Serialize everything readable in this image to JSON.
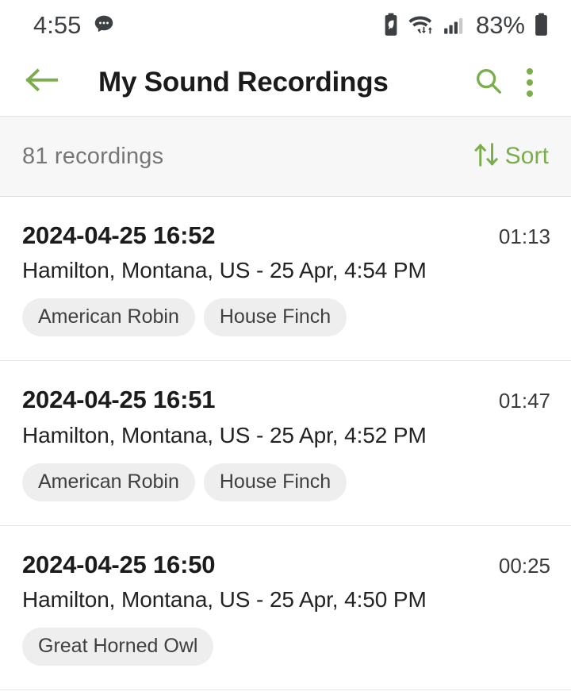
{
  "status_bar": {
    "time": "4:55",
    "message_icon": "chat-bubble-icon",
    "battery_saver_icon": "battery-saver-icon",
    "wifi_icon": "wifi-icon",
    "signal_icon": "cellular-signal-icon",
    "battery_percent": "83%",
    "battery_icon": "battery-icon"
  },
  "app_bar": {
    "back_icon": "back-arrow-icon",
    "title": "My Sound Recordings",
    "search_icon": "search-icon",
    "overflow_icon": "overflow-menu-icon"
  },
  "sort_bar": {
    "count_label": "81 recordings",
    "sort_label": "Sort",
    "sort_icon": "sort-arrows-icon"
  },
  "colors": {
    "accent_green": "#7aad4c",
    "title_black": "#1b1b1b",
    "muted_gray": "#767676",
    "chip_bg": "#eeeeee",
    "bar_bg": "#f7f7f7"
  },
  "recordings": [
    {
      "title": "2024-04-25 16:52",
      "duration": "01:13",
      "location": "Hamilton, Montana, US - 25 Apr, 4:54 PM",
      "tags": [
        "American Robin",
        "House Finch"
      ]
    },
    {
      "title": "2024-04-25 16:51",
      "duration": "01:47",
      "location": "Hamilton, Montana, US - 25 Apr, 4:52 PM",
      "tags": [
        "American Robin",
        "House Finch"
      ]
    },
    {
      "title": "2024-04-25 16:50",
      "duration": "00:25",
      "location": "Hamilton, Montana, US - 25 Apr, 4:50 PM",
      "tags": [
        "Great Horned Owl"
      ]
    }
  ]
}
